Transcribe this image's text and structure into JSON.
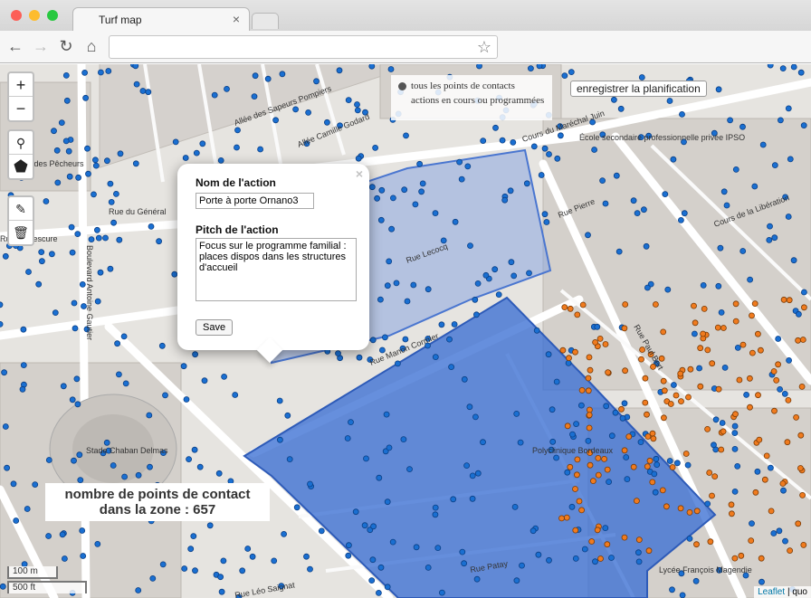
{
  "window": {
    "tab_title": "Turf map",
    "url": ""
  },
  "map": {
    "legend": {
      "line1": "tous les points de contacts",
      "line2": "actions en cours ou programmées"
    },
    "save_plan_label": "enregistrer la planification",
    "popup": {
      "close": "×",
      "name_label": "Nom de l'action",
      "name_value": "Porte à porte Ornano3",
      "pitch_label": "Pitch de l'action",
      "pitch_value": "Focus sur le programme familial : places dispos dans les structures d'accueil",
      "save_label": "Save"
    },
    "count_line1": "nombre de points de contact",
    "count_line2": "dans la zone : 657",
    "scale_m": "100 m",
    "scale_ft": "500 ft",
    "attribution_link": "Leaflet",
    "attribution_rest": "| quo",
    "street_labels": [
      "Allée des Sapeurs Pompiers",
      "Allée Camille Godard",
      "Cours du Maréchal Juin",
      "Rue du Général",
      "Rue de Lescure",
      "Allée des Pêcheurs",
      "Rue Lecocq",
      "Rue Pierre",
      "Cours de la Libération",
      "Rue Manon Cormier",
      "Rue Paul Bert",
      "Rue Léo Saignat",
      "Rue Patay",
      "Stade Chaban Delmas",
      "Polyclinique Bordeaux",
      "Lycée François Magendie",
      "École secondaire professionnelle privée IPSO",
      "Boulevard Antoine Gautier"
    ]
  },
  "colors": {
    "zone_fill": "#3b6fd4",
    "zone_light": "#8aa6e0",
    "point_blue": "#1a6fd1",
    "point_orange": "#f07b1e"
  },
  "icons": [
    "zoom-in-icon",
    "zoom-out-icon",
    "marker-icon",
    "polygon-icon",
    "edit-icon",
    "delete-icon",
    "back-icon",
    "forward-icon",
    "reload-icon",
    "home-icon",
    "star-icon"
  ]
}
